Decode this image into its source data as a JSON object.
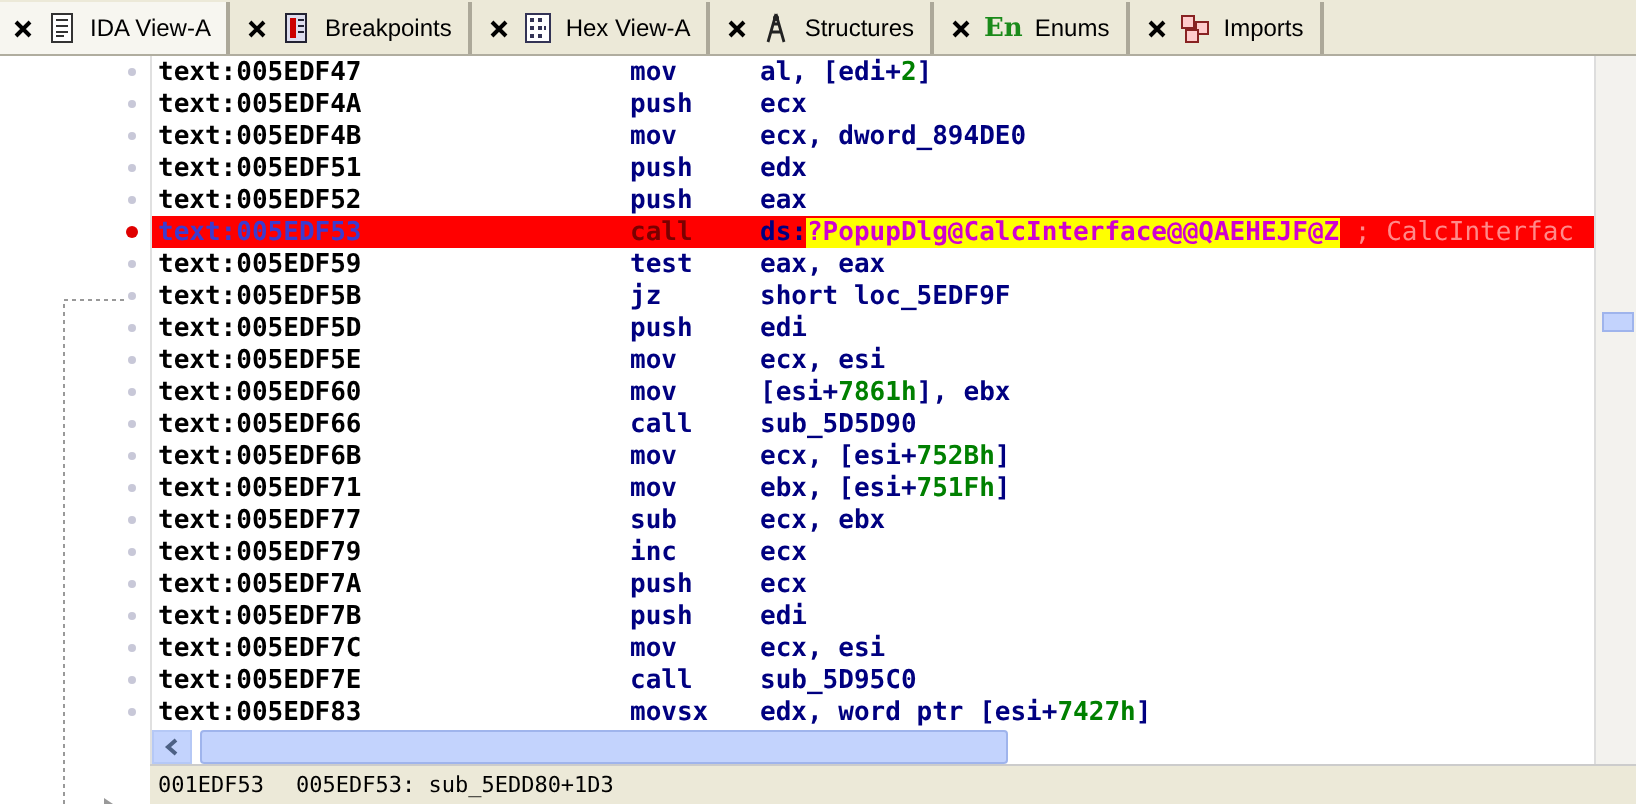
{
  "tabs": [
    {
      "label": "IDA View-A",
      "kind": "listing",
      "selected": true
    },
    {
      "label": "Breakpoints",
      "kind": "breakpoints",
      "selected": false
    },
    {
      "label": "Hex View-A",
      "kind": "hex",
      "selected": false
    },
    {
      "label": "Structures",
      "kind": "structures",
      "selected": false
    },
    {
      "label": "Enums",
      "kind": "enums",
      "icon_text": "En",
      "selected": false
    },
    {
      "label": "Imports",
      "kind": "imports",
      "selected": false
    }
  ],
  "listing": {
    "rows": [
      {
        "address": "text:005EDF47",
        "mnemonic": "mov",
        "operands": [
          {
            "kind": "plain",
            "text": "al, [edi+"
          },
          {
            "kind": "number",
            "text": "2"
          },
          {
            "kind": "plain",
            "text": "]"
          }
        ],
        "breakpoint": false
      },
      {
        "address": "text:005EDF4A",
        "mnemonic": "push",
        "operands": [
          {
            "kind": "plain",
            "text": "ecx"
          }
        ],
        "breakpoint": false
      },
      {
        "address": "text:005EDF4B",
        "mnemonic": "mov",
        "operands": [
          {
            "kind": "plain",
            "text": "ecx, dword_894DE0"
          }
        ],
        "breakpoint": false
      },
      {
        "address": "text:005EDF51",
        "mnemonic": "push",
        "operands": [
          {
            "kind": "plain",
            "text": "edx"
          }
        ],
        "breakpoint": false
      },
      {
        "address": "text:005EDF52",
        "mnemonic": "push",
        "operands": [
          {
            "kind": "plain",
            "text": "eax"
          }
        ],
        "breakpoint": false
      },
      {
        "address": "text:005EDF53",
        "mnemonic": "call",
        "operands": [
          {
            "kind": "plain",
            "text": "ds:"
          },
          {
            "kind": "name",
            "text": "?PopupDlg@CalcInterface@@QAEHEJF@Z"
          },
          {
            "kind": "comment",
            "text": " ; CalcInterfac"
          }
        ],
        "breakpoint": true
      },
      {
        "address": "text:005EDF59",
        "mnemonic": "test",
        "operands": [
          {
            "kind": "plain",
            "text": "eax, eax"
          }
        ],
        "breakpoint": false
      },
      {
        "address": "text:005EDF5B",
        "mnemonic": "jz",
        "operands": [
          {
            "kind": "plain",
            "text": "short loc_5EDF9F"
          }
        ],
        "breakpoint": false
      },
      {
        "address": "text:005EDF5D",
        "mnemonic": "push",
        "operands": [
          {
            "kind": "plain",
            "text": "edi"
          }
        ],
        "breakpoint": false
      },
      {
        "address": "text:005EDF5E",
        "mnemonic": "mov",
        "operands": [
          {
            "kind": "plain",
            "text": "ecx, esi"
          }
        ],
        "breakpoint": false
      },
      {
        "address": "text:005EDF60",
        "mnemonic": "mov",
        "operands": [
          {
            "kind": "plain",
            "text": "[esi+"
          },
          {
            "kind": "number",
            "text": "7861h"
          },
          {
            "kind": "plain",
            "text": "], ebx"
          }
        ],
        "breakpoint": false
      },
      {
        "address": "text:005EDF66",
        "mnemonic": "call",
        "operands": [
          {
            "kind": "plain",
            "text": "sub_5D5D90"
          }
        ],
        "breakpoint": false
      },
      {
        "address": "text:005EDF6B",
        "mnemonic": "mov",
        "operands": [
          {
            "kind": "plain",
            "text": "ecx, [esi+"
          },
          {
            "kind": "number",
            "text": "752Bh"
          },
          {
            "kind": "plain",
            "text": "]"
          }
        ],
        "breakpoint": false
      },
      {
        "address": "text:005EDF71",
        "mnemonic": "mov",
        "operands": [
          {
            "kind": "plain",
            "text": "ebx, [esi+"
          },
          {
            "kind": "number",
            "text": "751Fh"
          },
          {
            "kind": "plain",
            "text": "]"
          }
        ],
        "breakpoint": false
      },
      {
        "address": "text:005EDF77",
        "mnemonic": "sub",
        "operands": [
          {
            "kind": "plain",
            "text": "ecx, ebx"
          }
        ],
        "breakpoint": false
      },
      {
        "address": "text:005EDF79",
        "mnemonic": "inc",
        "operands": [
          {
            "kind": "plain",
            "text": "ecx"
          }
        ],
        "breakpoint": false
      },
      {
        "address": "text:005EDF7A",
        "mnemonic": "push",
        "operands": [
          {
            "kind": "plain",
            "text": "ecx"
          }
        ],
        "breakpoint": false
      },
      {
        "address": "text:005EDF7B",
        "mnemonic": "push",
        "operands": [
          {
            "kind": "plain",
            "text": "edi"
          }
        ],
        "breakpoint": false
      },
      {
        "address": "text:005EDF7C",
        "mnemonic": "mov",
        "operands": [
          {
            "kind": "plain",
            "text": "ecx, esi"
          }
        ],
        "breakpoint": false
      },
      {
        "address": "text:005EDF7E",
        "mnemonic": "call",
        "operands": [
          {
            "kind": "plain",
            "text": "sub_5D95C0"
          }
        ],
        "breakpoint": false
      },
      {
        "address": "text:005EDF83",
        "mnemonic": "movsx",
        "operands": [
          {
            "kind": "plain",
            "text": "edx, word ptr [esi+"
          },
          {
            "kind": "number",
            "text": "7427h"
          },
          {
            "kind": "plain",
            "text": "]"
          }
        ],
        "breakpoint": false
      }
    ]
  },
  "status_bar": [
    "001EDF53",
    "005EDF53: sub_5EDD80+1D3"
  ]
}
